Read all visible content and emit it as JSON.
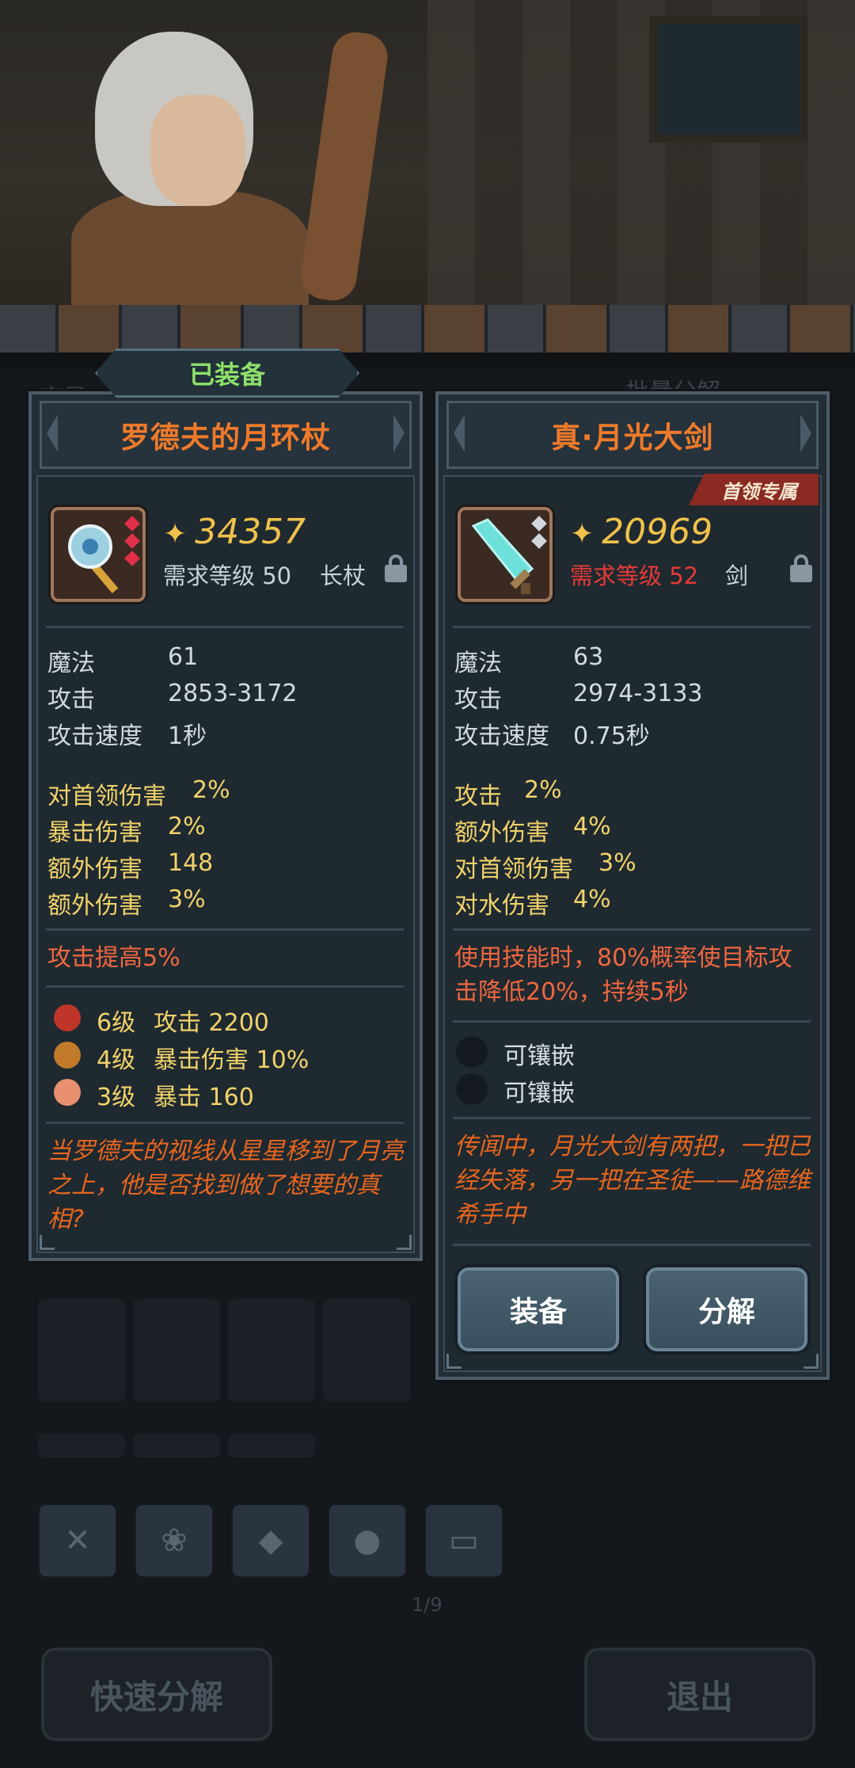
{
  "background": {
    "tab_hint": "容量",
    "batch_hint": "批量分解",
    "page_indicator": "1/9"
  },
  "equipped_tag": "已装备",
  "left_item": {
    "name": "罗德夫的月环杖",
    "price": "34357",
    "requirement": "需求等级 50",
    "type": "长杖",
    "stats": [
      {
        "label": "魔法",
        "value": "61"
      },
      {
        "label": "攻击",
        "value": "2853-3172"
      },
      {
        "label": "攻击速度",
        "value": "1秒"
      }
    ],
    "bonuses": [
      {
        "label": "对首领伤害",
        "value": "2%"
      },
      {
        "label": "暴击伤害",
        "value": "2%"
      },
      {
        "label": "额外伤害",
        "value": "148"
      },
      {
        "label": "额外伤害",
        "value": "3%"
      }
    ],
    "special": "攻击提高5%",
    "gems": [
      {
        "icon": "ruby-gem-icon",
        "level": "6级",
        "effect": "攻击 2200",
        "color": "#c0352a"
      },
      {
        "icon": "amber-gem-icon",
        "level": "4级",
        "effect": "暴击伤害 10%",
        "color": "#c07a2a"
      },
      {
        "icon": "pink-gem-icon",
        "level": "3级",
        "effect": "暴击 160",
        "color": "#e89070"
      }
    ],
    "lore": "当罗德夫的视线从星星移到了月亮之上，他是否找到做了想要的真相?"
  },
  "right_item": {
    "name": "真·月光大剑",
    "badge": "首领专属",
    "price": "20969",
    "requirement": "需求等级 52",
    "type": "剑",
    "stats": [
      {
        "label": "魔法",
        "value": "63"
      },
      {
        "label": "攻击",
        "value": "2974-3133"
      },
      {
        "label": "攻击速度",
        "value": "0.75秒"
      }
    ],
    "bonuses": [
      {
        "label": "攻击",
        "value": "2%"
      },
      {
        "label": "额外伤害",
        "value": "4%"
      },
      {
        "label": "对首领伤害",
        "value": "3%"
      },
      {
        "label": "对水伤害",
        "value": "4%"
      }
    ],
    "special": "使用技能时，80%概率使目标攻击降低20%，持续5秒",
    "sockets": [
      "可镶嵌",
      "可镶嵌"
    ],
    "lore": "传闻中，月光大剑有两把，一把已经失落，另一把在圣徒——路德维希手中",
    "equip_button": "装备",
    "dismantle_button": "分解"
  },
  "bottom": {
    "quick_dismantle": "快速分解",
    "exit": "退出"
  },
  "colors": {
    "title_orange": "#f07a2a",
    "price_gold": "#f0c24a",
    "bonus_yellow": "#f2d36a",
    "special_red": "#f0673f",
    "requirement_red": "#e63a36",
    "equipped_green": "#8ee06a"
  }
}
